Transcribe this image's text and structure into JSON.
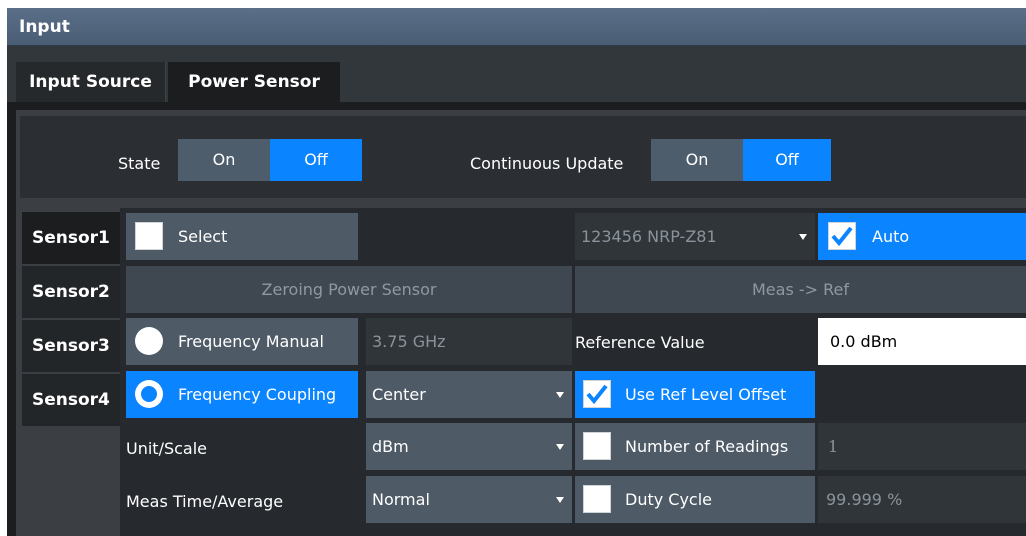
{
  "dialog": {
    "title": "Input"
  },
  "tabs": [
    {
      "label": "Input Source"
    },
    {
      "label": "Power Sensor"
    }
  ],
  "top": {
    "state_label": "State",
    "state_on": "On",
    "state_off": "Off",
    "continuous_label": "Continuous Update",
    "continuous_on": "On",
    "continuous_off": "Off"
  },
  "sensors": [
    {
      "label": "Sensor1"
    },
    {
      "label": "Sensor2"
    },
    {
      "label": "Sensor3"
    },
    {
      "label": "Sensor4"
    }
  ],
  "main": {
    "select_label": "Select",
    "sensor_dropdown_value": "123456 NRP-Z81",
    "auto_label": "Auto",
    "zeroing_label": "Zeroing Power Sensor",
    "meas_ref_label": "Meas -> Ref",
    "freq_manual_label": "Frequency Manual",
    "freq_manual_value": "3.75 GHz",
    "reference_value_label": "Reference Value",
    "reference_value": "0.0 dBm",
    "freq_coupling_label": "Frequency Coupling",
    "freq_coupling_value": "Center",
    "use_ref_offset_label": "Use Ref Level Offset",
    "unit_scale_label": "Unit/Scale",
    "unit_scale_value": "dBm",
    "num_readings_label": "Number of Readings",
    "num_readings_value": "1",
    "meas_time_label": "Meas Time/Average",
    "meas_time_value": "Normal",
    "duty_cycle_label": "Duty Cycle",
    "duty_cycle_value": "99.999 %"
  },
  "colors": {
    "accent": "#0a84ff",
    "title": "#4a5d74",
    "panel": "#3b3f44",
    "dark": "#1b1d1f"
  },
  "icons": [
    "checkbox-empty",
    "checkbox-checked",
    "radio-off",
    "radio-on",
    "dropdown-arrow"
  ]
}
